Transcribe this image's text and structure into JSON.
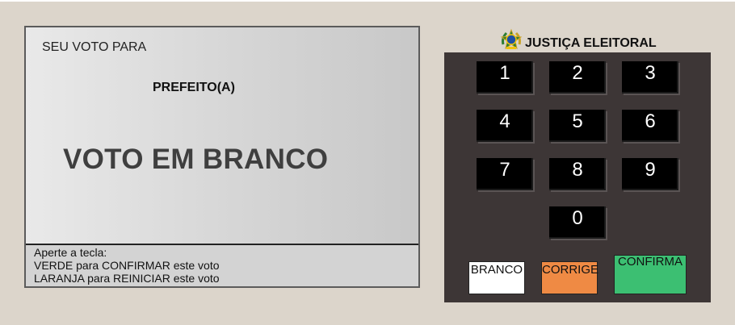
{
  "screen": {
    "vote_for_label": "SEU VOTO PARA",
    "office": "PREFEITO(A)",
    "vote_status": "VOTO EM BRANCO",
    "instructions": {
      "line1": "Aperte a tecla:",
      "line2": "VERDE para CONFIRMAR este voto",
      "line3": "LARANJA para REINICIAR este voto"
    }
  },
  "header": {
    "title": "JUSTIÇA ELEITORAL",
    "emblem_icon": "brazil-coat-of-arms-icon"
  },
  "keypad": {
    "digits": [
      "1",
      "2",
      "3",
      "4",
      "5",
      "6",
      "7",
      "8",
      "9",
      "0"
    ],
    "branco_label": "BRANCO",
    "corrige_label": "CORRIGE",
    "confirma_label": "CONFIRMA"
  },
  "colors": {
    "page_background": "#dcd5cb",
    "keypad_background": "#3d3636",
    "key_background": "#000000",
    "branco": "#ffffff",
    "corrige": "#ef8a44",
    "confirma": "#3cbf72"
  }
}
